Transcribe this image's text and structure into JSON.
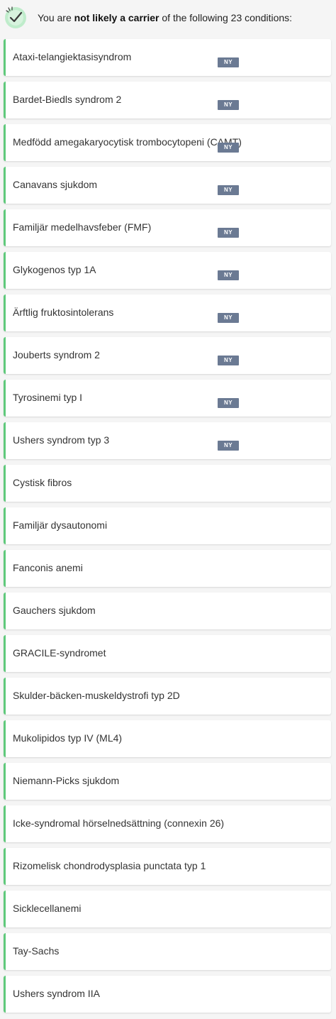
{
  "header": {
    "prefix": "You are ",
    "emphasis": "not likely a carrier",
    "suffix": " of the following 23 conditions:",
    "icon": "checkmark-circle-icon",
    "icon_color": "#5fc97b"
  },
  "colors": {
    "accent": "#5fc97b",
    "badge": "#6b7a93"
  },
  "conditions": [
    {
      "label": "Ataxi-telangiektasisyndrom",
      "badge": "NY"
    },
    {
      "label": "Bardet-Biedls syndrom 2",
      "badge": "NY"
    },
    {
      "label": "Medfödd amegakaryocytisk trombocytopeni (CAMT)",
      "badge": "NY"
    },
    {
      "label": "Canavans sjukdom",
      "badge": "NY"
    },
    {
      "label": "Familjär medelhavsfeber (FMF)",
      "badge": "NY"
    },
    {
      "label": "Glykogenos typ 1A",
      "badge": "NY"
    },
    {
      "label": "Ärftlig fruktosintolerans",
      "badge": "NY"
    },
    {
      "label": "Jouberts syndrom 2",
      "badge": "NY"
    },
    {
      "label": "Tyrosinemi typ I",
      "badge": "NY"
    },
    {
      "label": "Ushers syndrom typ 3",
      "badge": "NY"
    },
    {
      "label": "Cystisk fibros"
    },
    {
      "label": "Familjär dysautonomi"
    },
    {
      "label": "Fanconis anemi"
    },
    {
      "label": "Gauchers sjukdom"
    },
    {
      "label": "GRACILE-syndromet"
    },
    {
      "label": "Skulder-bäcken-muskeldystrofi typ 2D"
    },
    {
      "label": "Mukolipidos typ IV (ML4)"
    },
    {
      "label": "Niemann-Picks sjukdom"
    },
    {
      "label": "Icke-syndromal hörselnedsättning (connexin 26)"
    },
    {
      "label": "Rizomelisk chondrodysplasia punctata typ 1"
    },
    {
      "label": "Sicklecellanemi"
    },
    {
      "label": "Tay-Sachs"
    },
    {
      "label": "Ushers syndrom IIA"
    }
  ]
}
